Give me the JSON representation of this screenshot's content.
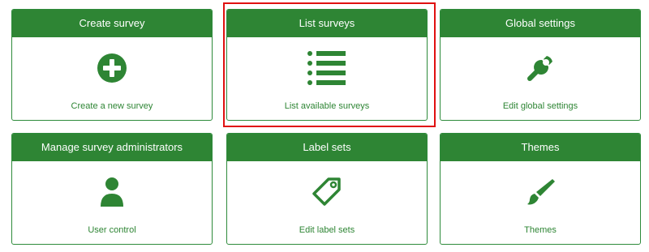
{
  "accent_color": "#2e8534",
  "highlight_color": "#e01010",
  "cards": [
    {
      "title": "Create survey",
      "link": "Create a new survey",
      "icon": "plus-circle-icon"
    },
    {
      "title": "List surveys",
      "link": "List available surveys",
      "icon": "list-icon",
      "highlighted": true
    },
    {
      "title": "Global settings",
      "link": "Edit global settings",
      "icon": "wrench-icon"
    },
    {
      "title": "Manage survey administrators",
      "link": "User control",
      "icon": "user-icon"
    },
    {
      "title": "Label sets",
      "link": "Edit label sets",
      "icon": "tag-icon"
    },
    {
      "title": "Themes",
      "link": "Themes",
      "icon": "paintbrush-icon"
    }
  ]
}
